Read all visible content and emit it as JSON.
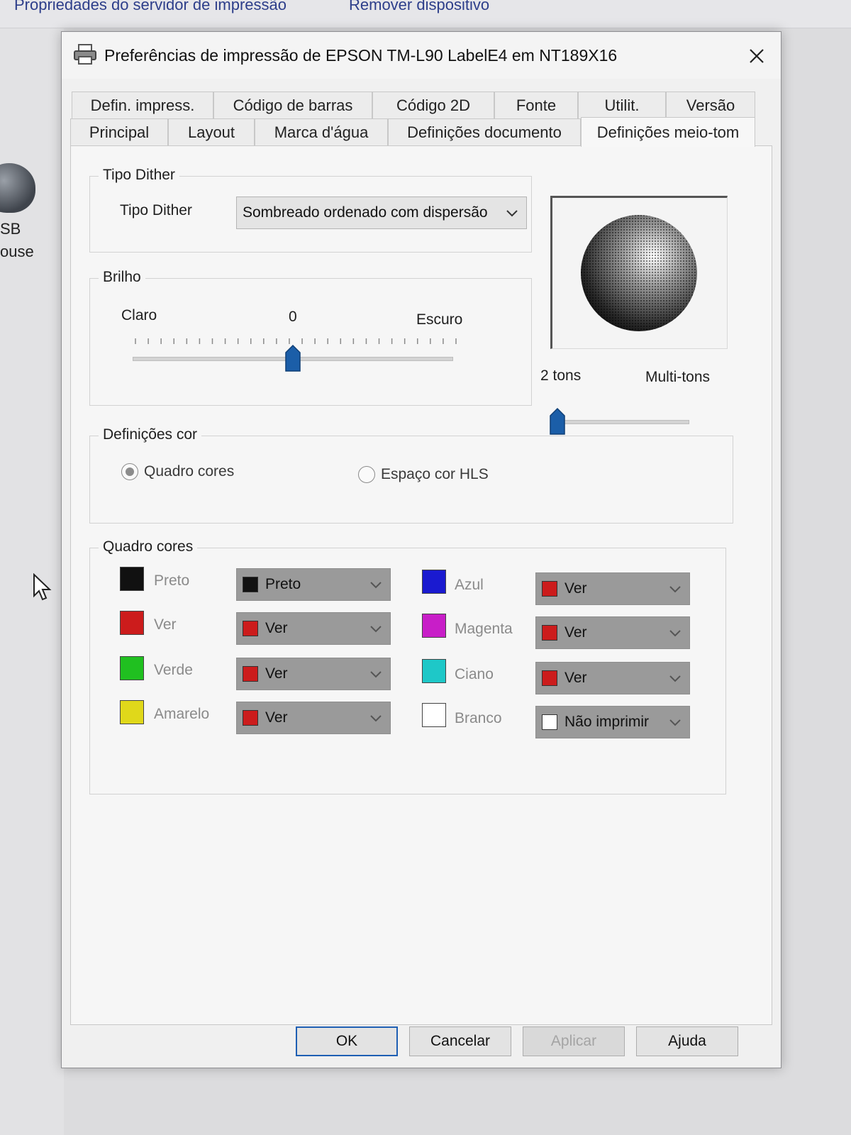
{
  "background": {
    "toolbar_links": [
      "Propriedades do servidor de impressão",
      "Remover dispositivo"
    ],
    "device_labels": [
      "SB",
      "ouse"
    ]
  },
  "dialog": {
    "title": "Preferências de impressão de EPSON TM-L90 LabelE4 em NT189X16",
    "close_glyph": "✕",
    "tabs_row1": [
      "Defin. impress.",
      "Código de barras",
      "Código 2D",
      "Fonte",
      "Utilit.",
      "Versão"
    ],
    "tabs_row2": [
      "Principal",
      "Layout",
      "Marca d'água",
      "Definições documento",
      "Definições meio-tom"
    ],
    "active_tab": "Definições meio-tom"
  },
  "dither": {
    "group_title": "Tipo Dither",
    "label": "Tipo Dither",
    "value": "Sombreado ordenado com dispersão"
  },
  "brightness": {
    "group_title": "Brilho",
    "left_label": "Claro",
    "value_label": "0",
    "right_label": "Escuro",
    "level": 0.5
  },
  "tone": {
    "left_label": "2 tons",
    "right_label": "Multi-tons",
    "level": 0.0
  },
  "color_settings": {
    "group_title": "Definições cor",
    "option1": "Quadro cores",
    "option2": "Espaço cor HLS",
    "selected": "Quadro cores"
  },
  "color_table": {
    "group_title": "Quadro cores",
    "rows": [
      {
        "name": "Preto",
        "swatch": "#111111",
        "value": "Preto",
        "value_swatch": "#111111"
      },
      {
        "name": "Ver",
        "swatch": "#cc1c1c",
        "value": "Ver",
        "value_swatch": "#cc1c1c"
      },
      {
        "name": "Verde",
        "swatch": "#20c020",
        "value": "Ver",
        "value_swatch": "#cc1c1c"
      },
      {
        "name": "Amarelo",
        "swatch": "#e0d81a",
        "value": "Ver",
        "value_swatch": "#cc1c1c"
      },
      {
        "name": "Azul",
        "swatch": "#1a1ad0",
        "value": "Ver",
        "value_swatch": "#cc1c1c"
      },
      {
        "name": "Magenta",
        "swatch": "#c81ec8",
        "value": "Ver",
        "value_swatch": "#cc1c1c"
      },
      {
        "name": "Ciano",
        "swatch": "#1ec8c8",
        "value": "Ver",
        "value_swatch": "#cc1c1c"
      },
      {
        "name": "Branco",
        "swatch": "#ffffff",
        "value": "Não imprimir",
        "value_swatch": "#ffffff"
      }
    ]
  },
  "buttons": {
    "ok": "OK",
    "cancel": "Cancelar",
    "apply": "Aplicar",
    "help": "Ajuda"
  }
}
